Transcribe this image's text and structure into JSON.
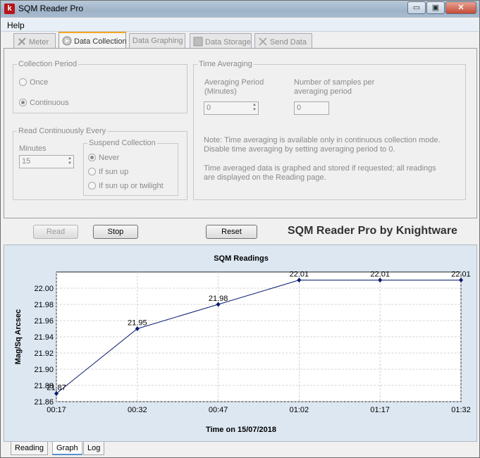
{
  "window": {
    "title": "SQM Reader Pro",
    "icon_letter": "k",
    "minimize": "▭",
    "restore": "▣",
    "close": "✕"
  },
  "menu": {
    "help": "Help"
  },
  "tabs": [
    {
      "label": "Meter",
      "icon": "meter-icon",
      "active": false
    },
    {
      "label": "Data Collection",
      "icon": "play-icon",
      "active": true
    },
    {
      "label": "Data Graphing",
      "icon": "",
      "active": false
    },
    {
      "label": "Data Storage",
      "icon": "storage-icon",
      "active": false
    },
    {
      "label": "Send Data",
      "icon": "send-icon",
      "active": false
    }
  ],
  "collection_period": {
    "title": "Collection Period",
    "once": "Once",
    "continuous": "Continuous",
    "selected": "Continuous"
  },
  "read_every": {
    "title": "Read Continuously Every",
    "minutes_label": "Minutes",
    "minutes_value": "15",
    "suspend": {
      "title": "Suspend Collection",
      "never": "Never",
      "sun_up": "If sun up",
      "sun_up_twilight": "If sun up or twilight",
      "selected": "Never"
    }
  },
  "time_averaging": {
    "title": "Time Averaging",
    "period_label_1": "Averaging Period",
    "period_label_2": "(Minutes)",
    "period_value": "0",
    "samples_label_1": "Number of samples per",
    "samples_label_2": "averaging period",
    "samples_value": "0",
    "note_1": "Note: Time averaging is available only in continuous collection mode.",
    "note_2": "Disable time averaging by setting averaging period to 0.",
    "note_3": "Time averaged data is graphed and stored if requested; all readings",
    "note_4": "are displayed on the Reading page."
  },
  "buttons": {
    "read": "Read",
    "stop": "Stop",
    "reset": "Reset"
  },
  "brand": "SQM Reader Pro by Knightware",
  "bottom_tabs": [
    {
      "label": "Reading",
      "active": false
    },
    {
      "label": "Graph",
      "active": true
    },
    {
      "label": "Log",
      "active": false
    }
  ],
  "chart_data": {
    "type": "line",
    "title": "SQM Readings",
    "xlabel": "Time on 15/07/2018",
    "ylabel": "Mag/Sq Arcsec",
    "x_ticks": [
      "00:17",
      "00:32",
      "00:47",
      "01:02",
      "01:17",
      "01:32"
    ],
    "ylim": [
      21.86,
      22.02
    ],
    "y_ticks": [
      "21.86",
      "21.88",
      "21.90",
      "21.92",
      "21.94",
      "21.96",
      "21.98",
      "22.00"
    ],
    "grid": true,
    "series": [
      {
        "points": [
          {
            "x": "00:17",
            "y": 21.87,
            "label": "21.87"
          },
          {
            "x": "00:32",
            "y": 21.95,
            "label": "21.95"
          },
          {
            "x": "00:47",
            "y": 21.98,
            "label": "21.98"
          },
          {
            "x": "01:02",
            "y": 22.01,
            "label": "22.01"
          },
          {
            "x": "01:17",
            "y": 22.01,
            "label": "22.01"
          },
          {
            "x": "01:32",
            "y": 22.01,
            "label": "22.01"
          }
        ],
        "color": "#0a1a6e"
      }
    ]
  }
}
